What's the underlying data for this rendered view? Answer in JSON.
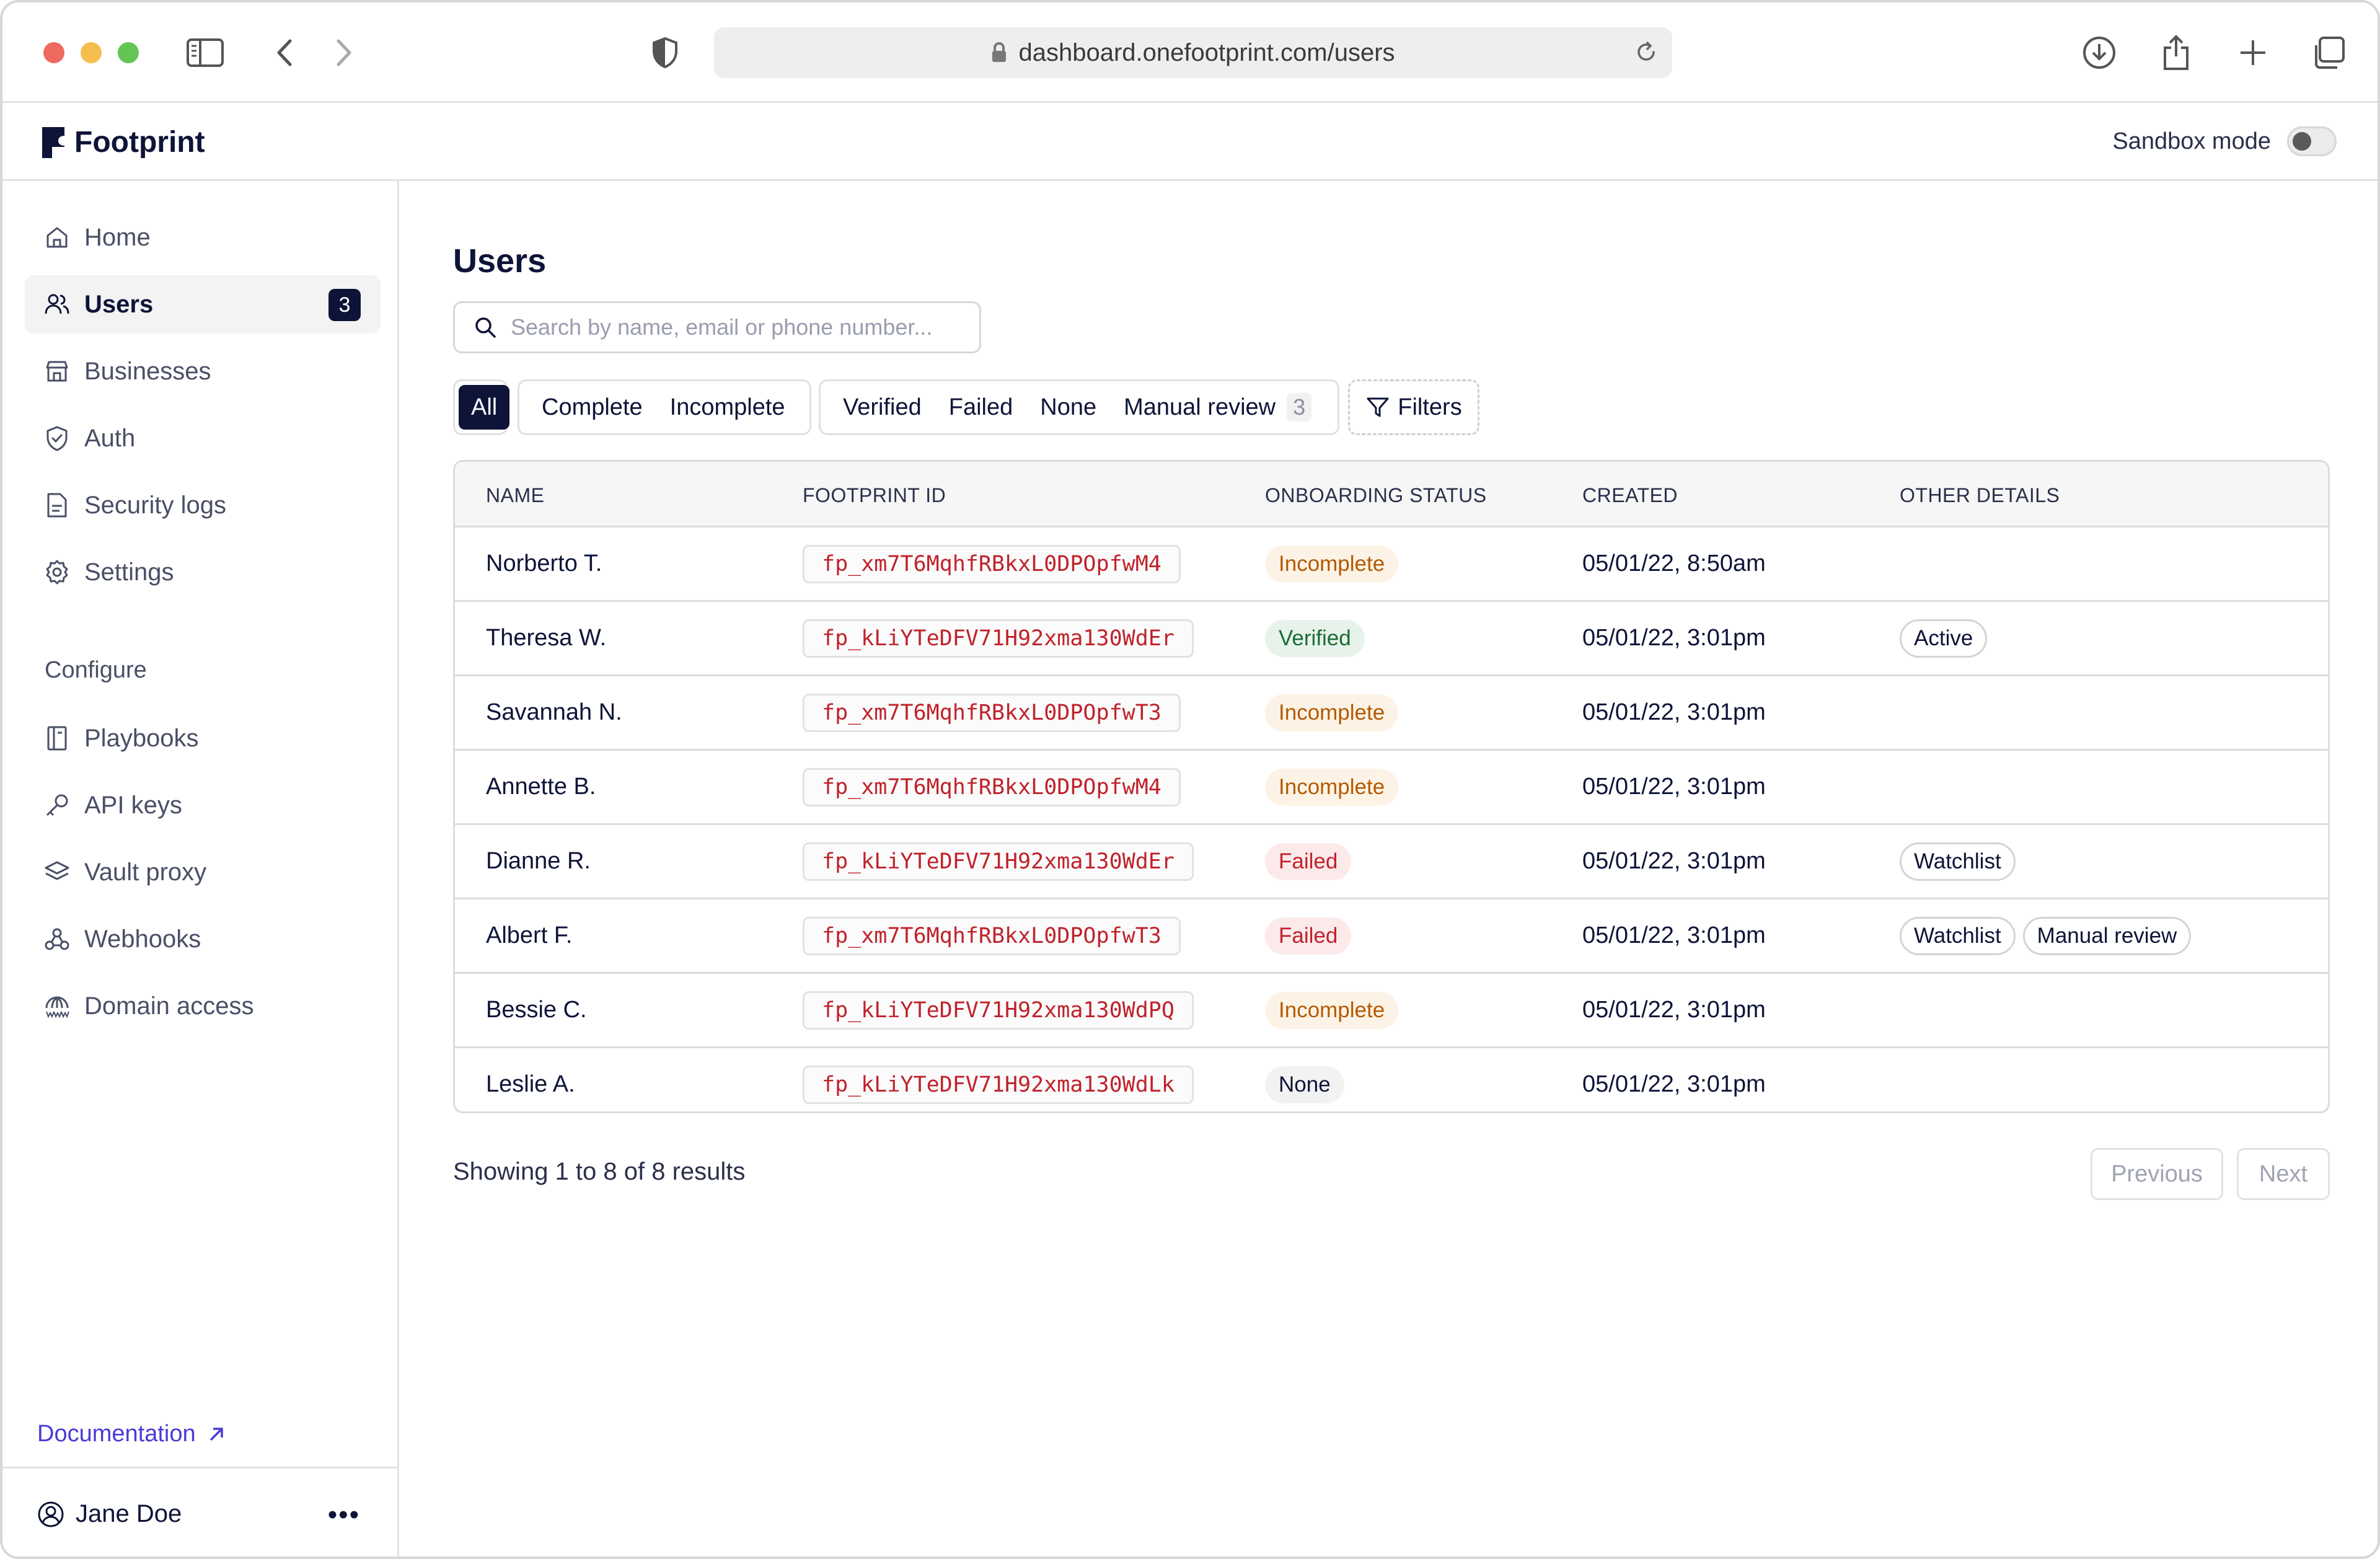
{
  "browser": {
    "url": "dashboard.onefootprint.com/users"
  },
  "app": {
    "brand": "Footprint",
    "sandbox_label": "Sandbox mode",
    "sandbox_enabled": false
  },
  "sidebar": {
    "items": [
      {
        "label": "Home",
        "icon": "home-icon"
      },
      {
        "label": "Users",
        "icon": "users-icon",
        "count": "3",
        "active": true
      },
      {
        "label": "Businesses",
        "icon": "store-icon"
      },
      {
        "label": "Auth",
        "icon": "shield-check-icon"
      },
      {
        "label": "Security logs",
        "icon": "document-icon"
      },
      {
        "label": "Settings",
        "icon": "gear-icon"
      }
    ],
    "configure_label": "Configure",
    "configure_items": [
      {
        "label": "Playbooks",
        "icon": "book-icon"
      },
      {
        "label": "API keys",
        "icon": "key-icon"
      },
      {
        "label": "Vault proxy",
        "icon": "layers-icon"
      },
      {
        "label": "Webhooks",
        "icon": "webhook-icon"
      },
      {
        "label": "Domain access",
        "icon": "globe-www-icon"
      }
    ],
    "documentation": "Documentation",
    "user_name": "Jane Doe"
  },
  "main": {
    "title": "Users",
    "search_placeholder": "Search by name, email or phone number...",
    "filter_all": "All",
    "filter_complete": "Complete",
    "filter_incomplete": "Incomplete",
    "filter_verified": "Verified",
    "filter_failed": "Failed",
    "filter_none": "None",
    "filter_manual_review": "Manual review",
    "manual_review_count": "3",
    "filters_button": "Filters",
    "columns": [
      "NAME",
      "FOOTPRINT ID",
      "ONBOARDING STATUS",
      "CREATED",
      "OTHER DETAILS"
    ],
    "rows": [
      {
        "name": "Norberto T.",
        "id": "fp_xm7T6MqhfRBkxL0DPOpfwM4",
        "status": "Incomplete",
        "status_kind": "incomplete",
        "created": "05/01/22, 8:50am",
        "details": []
      },
      {
        "name": "Theresa W.",
        "id": "fp_kLiYTeDFV71H92xma130WdEr",
        "status": "Verified",
        "status_kind": "verified",
        "created": "05/01/22, 3:01pm",
        "details": [
          "Active"
        ]
      },
      {
        "name": "Savannah N.",
        "id": "fp_xm7T6MqhfRBkxL0DPOpfwT3",
        "status": "Incomplete",
        "status_kind": "incomplete",
        "created": "05/01/22, 3:01pm",
        "details": []
      },
      {
        "name": "Annette B.",
        "id": "fp_xm7T6MqhfRBkxL0DPOpfwM4",
        "status": "Incomplete",
        "status_kind": "incomplete",
        "created": "05/01/22, 3:01pm",
        "details": []
      },
      {
        "name": "Dianne R.",
        "id": "fp_kLiYTeDFV71H92xma130WdEr",
        "status": "Failed",
        "status_kind": "failed",
        "created": "05/01/22, 3:01pm",
        "details": [
          "Watchlist"
        ]
      },
      {
        "name": "Albert F.",
        "id": "fp_xm7T6MqhfRBkxL0DPOpfwT3",
        "status": "Failed",
        "status_kind": "failed",
        "created": "05/01/22, 3:01pm",
        "details": [
          "Watchlist",
          "Manual review"
        ]
      },
      {
        "name": "Bessie C.",
        "id": "fp_kLiYTeDFV71H92xma130WdPQ",
        "status": "Incomplete",
        "status_kind": "incomplete",
        "created": "05/01/22, 3:01pm",
        "details": []
      },
      {
        "name": "Leslie A.",
        "id": "fp_kLiYTeDFV71H92xma130WdLk",
        "status": "None",
        "status_kind": "none",
        "created": "05/01/22, 3:01pm",
        "details": []
      }
    ],
    "showing": "Showing 1 to 8 of 8 results",
    "previous": "Previous",
    "next": "Next"
  },
  "colors": {
    "brand": "#0e1438",
    "link": "#4a3bd6",
    "id_text": "#c0222b",
    "incomplete": "#b45a00",
    "verified": "#1b6b36",
    "failed": "#c0222b"
  }
}
